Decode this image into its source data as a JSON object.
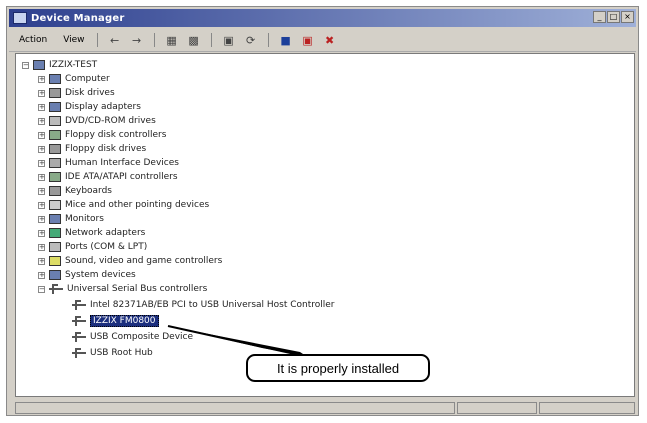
{
  "window": {
    "title": "Device Manager",
    "buttons": [
      "_",
      "□",
      "×"
    ]
  },
  "toolbar": {
    "menus": [
      "Action",
      "View"
    ],
    "icons": [
      "back-arrow",
      "forward-arrow",
      "properties",
      "print",
      "scan-hardware",
      "refresh",
      "uninstall",
      "disable"
    ]
  },
  "tree": {
    "root": "IZZIX-TEST",
    "categories": [
      "Computer",
      "Disk drives",
      "Display adapters",
      "DVD/CD-ROM drives",
      "Floppy disk controllers",
      "Floppy disk drives",
      "Human Interface Devices",
      "IDE ATA/ATAPI controllers",
      "Keyboards",
      "Mice and other pointing devices",
      "Monitors",
      "Network adapters",
      "Ports (COM & LPT)",
      "Sound, video and game controllers",
      "System devices",
      "Universal Serial Bus controllers"
    ],
    "usb_children": [
      "Intel 82371AB/EB PCI to USB Universal Host Controller",
      "IZZIX FM0800",
      "USB Composite Device",
      "USB Root Hub"
    ]
  },
  "callout": {
    "text": "It is properly installed"
  }
}
